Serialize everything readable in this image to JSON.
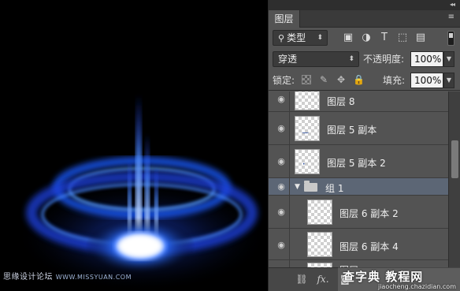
{
  "panel": {
    "tab_title": "图层",
    "collapse_glyph": "◂◂",
    "menu_glyph": "≡"
  },
  "filter": {
    "label": "类型",
    "icons": [
      "image-filter-icon",
      "adjustment-filter-icon",
      "type-filter-icon",
      "shape-filter-icon",
      "smart-object-filter-icon"
    ]
  },
  "blend": {
    "mode": "穿透",
    "opacity_label": "不透明度:",
    "opacity_value": "100%"
  },
  "lock": {
    "label": "锁定:",
    "fill_label": "填充:",
    "fill_value": "100%"
  },
  "layers": [
    {
      "name": "图层 8",
      "type": "layer",
      "indent": 0,
      "thumb_mark": ""
    },
    {
      "name": "图层 5 副本",
      "type": "layer",
      "indent": 0,
      "thumb_mark": "‿"
    },
    {
      "name": "图层 5 副本 2",
      "type": "layer",
      "indent": 0,
      "thumb_mark": "·"
    },
    {
      "name": "组 1",
      "type": "group",
      "indent": 0,
      "expanded": true
    },
    {
      "name": "图层 6 副本 2",
      "type": "layer",
      "indent": 1,
      "thumb_mark": ""
    },
    {
      "name": "图层 6 副本 4",
      "type": "layer",
      "indent": 1,
      "thumb_mark": ""
    },
    {
      "name": "图层",
      "type": "layer",
      "indent": 1,
      "thumb_mark": ""
    }
  ],
  "bottom_icons": [
    "link-layers-icon",
    "fx-icon",
    "layer-mask-icon"
  ],
  "watermarks": {
    "left_text": "思缘设计论坛",
    "left_url": "WWW.MISSYUAN.COM",
    "right_text": "查字典 教程网",
    "right_url": "jiaocheng.chazidian.com"
  }
}
